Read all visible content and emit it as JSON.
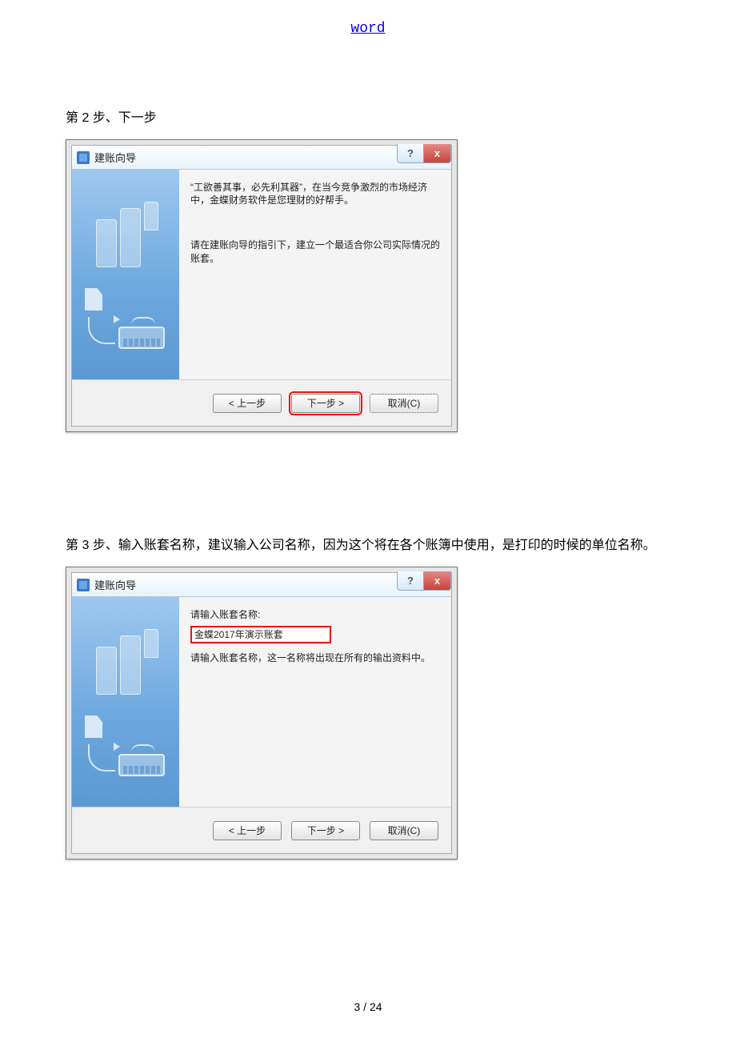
{
  "header": {
    "link_text": "word"
  },
  "step2": {
    "heading": "第 2 步、下一步",
    "dialog": {
      "title": "建账向导",
      "paragraph1": "“工欲善其事，必先利其器”，在当今竞争激烈的市场经济中，金蝶财务软件是您理财的好帮手。",
      "paragraph2": "请在建账向导的指引下，建立一个最适合你公司实际情况的账套。",
      "buttons": {
        "back": "< 上一步",
        "next": "下一步 >",
        "cancel": "取消(C)"
      }
    }
  },
  "step3": {
    "heading": "第 3 步、输入账套名称，建议输入公司名称，因为这个将在各个账簿中使用，是打印的时候的单位名称。",
    "dialog": {
      "title": "建账向导",
      "label": "请输入账套名称:",
      "account_name_value": "金蝶2017年演示账套",
      "hint": "请输入账套名称，这一名称将出现在所有的输出资料中。",
      "buttons": {
        "back": "< 上一步",
        "next": "下一步 >",
        "cancel": "取消(C)"
      }
    }
  },
  "pager": {
    "current": "3",
    "sep": " / ",
    "total": "24"
  }
}
